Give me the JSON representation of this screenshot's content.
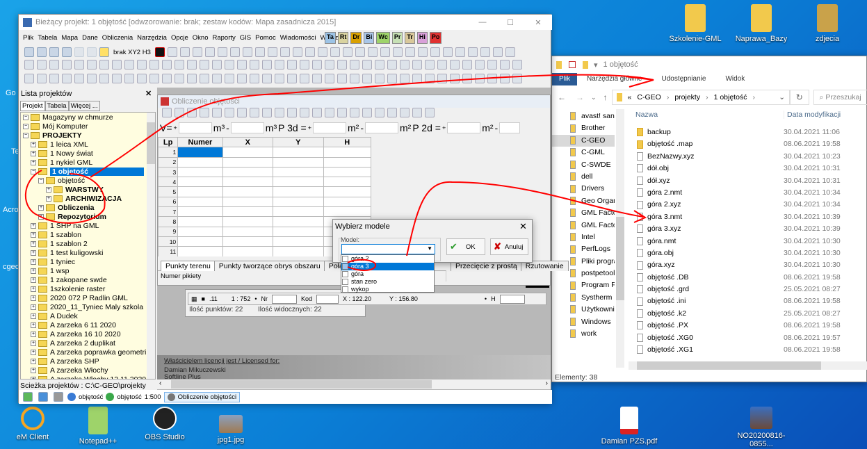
{
  "desktop": {
    "top_icons": [
      "Szkolenie-GML",
      "Naprawa_Bazy",
      "zdjecia"
    ],
    "bottom_icons": [
      "eM Client",
      "Notepad++",
      "OBS Studio",
      "jpg1.jpg",
      "Damian PZS.pdf",
      "NO20200816-0855..."
    ],
    "left_partial_labels": [
      "Go",
      "Te",
      "Acro",
      "cgeo"
    ]
  },
  "main_window": {
    "title": "Bieżący projekt: 1 objętość [odwzorowanie: brak; zestaw kodów: Mapa zasadnicza 2015]",
    "menu": [
      "Plik",
      "Tabela",
      "Mapa",
      "Dane",
      "Obliczenia",
      "Narzędzia",
      "Opcje",
      "Okno",
      "Raporty",
      "GIS",
      "Pomoc",
      "Wiadomości",
      "Wtyczki"
    ],
    "plugin_buttons": [
      {
        "label": "Ta",
        "color": "#9cc3e6"
      },
      {
        "label": "Rt",
        "color": "#d9d3a0"
      },
      {
        "label": "Dr",
        "color": "#d9a000"
      },
      {
        "label": "Bi",
        "color": "#a9c6e8"
      },
      {
        "label": "Wc",
        "color": "#9ed36a"
      },
      {
        "label": "Pr",
        "color": "#c6e0b4"
      },
      {
        "label": "Tr",
        "color": "#d9c89a"
      },
      {
        "label": "Hi",
        "color": "#d9a0d9"
      },
      {
        "label": "Po",
        "color": "#e03030"
      }
    ],
    "toolbar_text": "brak XY2 H3",
    "project_panel": {
      "title": "Lista projektów",
      "tabs": [
        "Projekt",
        "Tabela",
        "Więcej ..."
      ],
      "tree": [
        {
          "label": "Magazyny w chmurze",
          "level": 0
        },
        {
          "label": "Mój Komputer",
          "level": 0
        },
        {
          "label": "PROJEKTY",
          "level": 0,
          "bold": true
        },
        {
          "label": "1 leica XML",
          "level": 1
        },
        {
          "label": "1 Nowy świat",
          "level": 1
        },
        {
          "label": "1 nykiel GML",
          "level": 1
        },
        {
          "label": "1 objętość",
          "level": 1,
          "selected": true,
          "bold": true
        },
        {
          "label": "objętość",
          "level": 2
        },
        {
          "label": "WARSTWY",
          "level": 3,
          "bold": true
        },
        {
          "label": "ARCHIWIZACJA",
          "level": 3,
          "bold": true
        },
        {
          "label": "Obliczenia",
          "level": 2,
          "bold": true
        },
        {
          "label": "Repozytorium",
          "level": 2,
          "bold": true
        },
        {
          "label": "1 SHP na GML",
          "level": 1
        },
        {
          "label": "1 szablon",
          "level": 1
        },
        {
          "label": "1 szablon 2",
          "level": 1
        },
        {
          "label": "1 test kuligowski",
          "level": 1
        },
        {
          "label": "1 tyniec",
          "level": 1
        },
        {
          "label": "1 wsp",
          "level": 1
        },
        {
          "label": "1 zakopane swde",
          "level": 1
        },
        {
          "label": "1szkolenie raster",
          "level": 1
        },
        {
          "label": "2020 072 P Radlin GML",
          "level": 1
        },
        {
          "label": "2020_11_Tyniec Maly szkola",
          "level": 1
        },
        {
          "label": "A Dudek",
          "level": 1
        },
        {
          "label": "A zarzeka  6 11 2020",
          "level": 1
        },
        {
          "label": "A zarzeka 16 10 2020",
          "level": 1
        },
        {
          "label": "A zarzeka 2 duplikat",
          "level": 1
        },
        {
          "label": "A zarzeka poprawka geometrii",
          "level": 1
        },
        {
          "label": "A zarzeka SHP",
          "level": 1
        },
        {
          "label": "A zarzeka Włochy",
          "level": 1
        },
        {
          "label": "A zarzeka Włochy 12 11 2020",
          "level": 1
        }
      ],
      "path": "Scieżka projektów : C:\\C-GEO\\projekty"
    },
    "status": {
      "item1": "objętość",
      "item2": "objętość",
      "scale": "1:500",
      "active_window": "Obliczenie objętości"
    },
    "license": {
      "heading": "Właścicielem licencji jest / Licensed for:",
      "line1": "Damian Mikuczewski",
      "line2": "Softline Plus"
    }
  },
  "volume_window": {
    "title": "Obliczenie objętości",
    "fields": {
      "v": "V=",
      "p3d": "P 3d =",
      "p2d": "P 2d =",
      "m3": "m³",
      "m2": "m²",
      "plus": "+",
      "minus": "-"
    },
    "columns": [
      "Lp",
      "Numer",
      "X",
      "Y",
      "H"
    ],
    "rows": [
      "1",
      "2",
      "3",
      "4",
      "5",
      "6",
      "7",
      "8",
      "9",
      "10",
      "11"
    ],
    "tabs": [
      "Punkty terenu",
      "Punkty tworzące obrys obszaru",
      "Połącz...",
      "Przecięcie z prostą",
      "Rzutowanie"
    ],
    "status_field": "Numer pikiety"
  },
  "map_status": {
    "scale": "1 : 752",
    "nr_label": "Nr",
    "kod_label": "Kod",
    "x": "X : 122.20",
    "y": "Y : 156.80",
    "h_label": "H",
    "points": "Ilość punktów: 22",
    "visible": "Ilość widocznych: 22"
  },
  "dialog": {
    "title": "Wybierz modele",
    "group_label": "Model:",
    "ok": "OK",
    "cancel": "Anuluj",
    "options": [
      {
        "label": "góra 2",
        "selected": false
      },
      {
        "label": "góra 3",
        "selected": true
      },
      {
        "label": "góra",
        "selected": false
      },
      {
        "label": "stan zero",
        "selected": false
      },
      {
        "label": "wykop",
        "selected": false
      }
    ]
  },
  "explorer": {
    "title": "1 objętość",
    "ribbon_tabs": [
      "Plik",
      "Narzędzia główne",
      "Udostępnianie",
      "Widok"
    ],
    "breadcrumb": [
      "«",
      "C-GEO",
      "projekty",
      "1 objętość"
    ],
    "search_placeholder": "Przeszukaj",
    "nav": [
      "avast! sandbox",
      "Brother",
      "C-GEO",
      "C-GML",
      "C-SWDE",
      "dell",
      "Drivers",
      "Geo Organizer",
      "GML Factory",
      "GML Factory",
      "Intel",
      "PerfLogs",
      "Pliki programów",
      "postpetools",
      "Program Files",
      "Systherm Info",
      "Użytkownicy",
      "Windows",
      "work"
    ],
    "nav_selected": "C-GEO",
    "col_name": "Nazwa",
    "col_date": "Data modyfikacji",
    "files": [
      {
        "name": "backup",
        "date": "30.04.2021 11:06",
        "type": "folder"
      },
      {
        "name": "objętość .map",
        "date": "08.06.2021 19:58",
        "type": "folder"
      },
      {
        "name": "BezNazwy.xyz",
        "date": "30.04.2021 10:23",
        "type": "file"
      },
      {
        "name": "dół.obj",
        "date": "30.04.2021 10:31",
        "type": "file"
      },
      {
        "name": "dół.xyz",
        "date": "30.04.2021 10:31",
        "type": "file"
      },
      {
        "name": "góra 2.nmt",
        "date": "30.04.2021 10:34",
        "type": "file"
      },
      {
        "name": "góra 2.xyz",
        "date": "30.04.2021 10:34",
        "type": "file"
      },
      {
        "name": "góra 3.nmt",
        "date": "30.04.2021 10:39",
        "type": "file"
      },
      {
        "name": "góra 3.xyz",
        "date": "30.04.2021 10:39",
        "type": "file"
      },
      {
        "name": "góra.nmt",
        "date": "30.04.2021 10:30",
        "type": "file"
      },
      {
        "name": "góra.obj",
        "date": "30.04.2021 10:30",
        "type": "file"
      },
      {
        "name": "góra.xyz",
        "date": "30.04.2021 10:30",
        "type": "file"
      },
      {
        "name": "objętość .DB",
        "date": "08.06.2021 19:58",
        "type": "file"
      },
      {
        "name": "objętość .grd",
        "date": "25.05.2021 08:27",
        "type": "file"
      },
      {
        "name": "objętość .ini",
        "date": "08.06.2021 19:58",
        "type": "file"
      },
      {
        "name": "objętość .k2",
        "date": "25.05.2021 08:27",
        "type": "file"
      },
      {
        "name": "objętość .PX",
        "date": "08.06.2021 19:58",
        "type": "file"
      },
      {
        "name": "objętość .XG0",
        "date": "08.06.2021 19:57",
        "type": "file"
      },
      {
        "name": "objętość .XG1",
        "date": "08.06.2021 19:58",
        "type": "file"
      }
    ],
    "status": "Elementy: 38"
  },
  "colors": {
    "selection": "#0078d7",
    "annotation": "#ff0000",
    "tree_bg": "#fffde0"
  }
}
